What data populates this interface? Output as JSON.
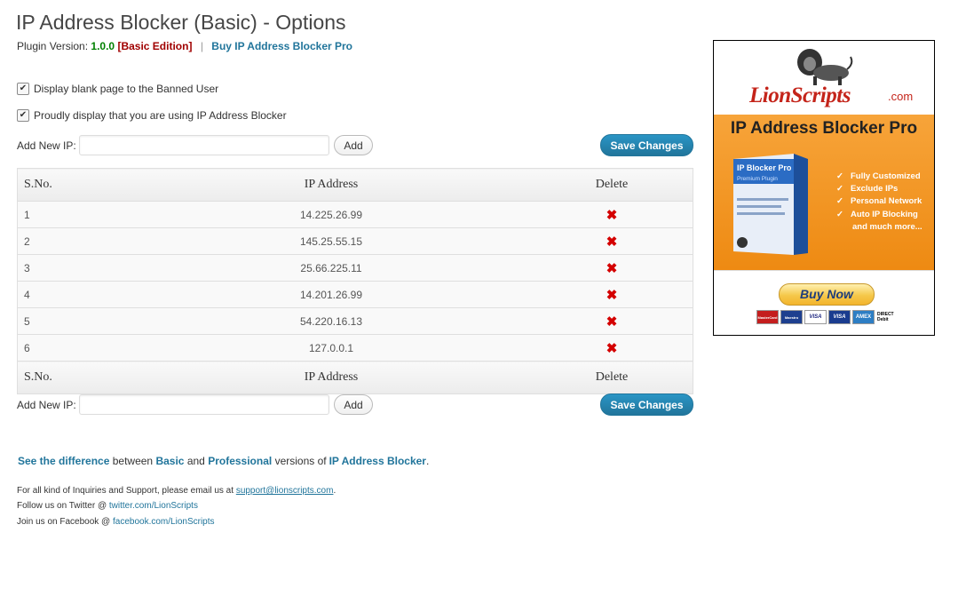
{
  "page": {
    "title": "IP Address Blocker (Basic) - Options",
    "version_label": "Plugin Version:",
    "version": "1.0.0",
    "edition": "[Basic Edition]",
    "separator": "|",
    "buy_pro_link": "Buy IP Address Blocker Pro"
  },
  "options": {
    "blank_page": {
      "label": "Display blank page to the Banned User",
      "checked": true
    },
    "proudly": {
      "label": "Proudly display that you are using IP Address Blocker",
      "checked": true
    }
  },
  "add_form": {
    "label": "Add New IP:",
    "input_value": "",
    "add_button": "Add",
    "save_button": "Save Changes"
  },
  "table": {
    "headers": {
      "sno": "S.No.",
      "ip": "IP Address",
      "delete": "Delete"
    },
    "rows": [
      {
        "sno": "1",
        "ip": "14.225.26.99"
      },
      {
        "sno": "2",
        "ip": "145.25.55.15"
      },
      {
        "sno": "3",
        "ip": "25.66.225.11"
      },
      {
        "sno": "4",
        "ip": "14.201.26.99"
      },
      {
        "sno": "5",
        "ip": "54.220.16.13"
      },
      {
        "sno": "6",
        "ip": "127.0.0.1"
      }
    ],
    "delete_icon": "red-x-icon"
  },
  "footer": {
    "diff": {
      "link": "See the difference",
      "between": "between",
      "basic": "Basic",
      "and": "and",
      "professional": "Professional",
      "versions_of": "versions of",
      "product": "IP Address Blocker",
      "period": "."
    },
    "support_text": "For all kind of Inquiries and Support, please email us at",
    "support_email": "support@lionscripts.com",
    "support_end": ".",
    "twitter_text": "Follow us on Twitter @",
    "twitter_link": "twitter.com/LionScripts",
    "facebook_text": "Join us on Facebook @",
    "facebook_link": "facebook.com/LionScripts"
  },
  "ad": {
    "logo_text": "LionScripts",
    "logo_suffix": ".com",
    "promo_title": "IP Address Blocker Pro",
    "box_title": "IP Blocker Pro",
    "box_subtitle": "Premium Plugin",
    "features": [
      "Fully Customized",
      "Exclude IPs",
      "Personal Network",
      "Auto IP Blocking"
    ],
    "more": "and much more...",
    "buy_now": "Buy Now",
    "cards": [
      "MasterCard",
      "Maestro",
      "VISA",
      "VISA",
      "AMEX",
      "DIRECT Debit"
    ],
    "accent": "#ee8a12"
  },
  "colors": {
    "link": "#21759b",
    "version_green": "#008000",
    "edition_red": "#a00000",
    "delete_red": "#d40000"
  }
}
